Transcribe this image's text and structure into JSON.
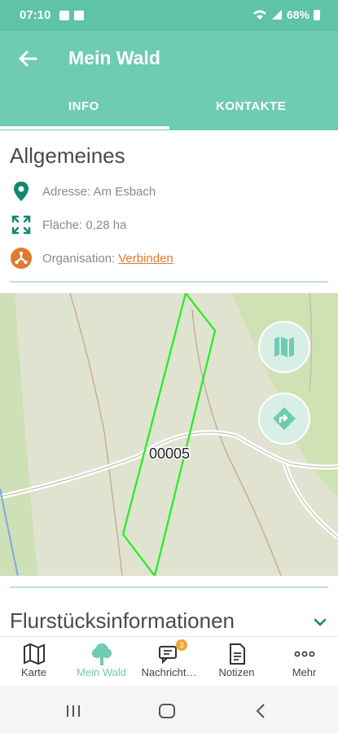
{
  "status": {
    "time": "07:10",
    "battery": "68%"
  },
  "header": {
    "title": "Mein Wald"
  },
  "tabs": [
    {
      "label": "INFO"
    },
    {
      "label": "KONTAKTE"
    }
  ],
  "general": {
    "title": "Allgemeines",
    "address": "Adresse: Am Esbach",
    "area": "Fläche: 0,28 ha",
    "organisation_label": "Organisation:",
    "organisation_link": "Verbinden"
  },
  "map": {
    "parcel_label": "00005"
  },
  "parcel_info": {
    "title": "Flurstücksinformationen"
  },
  "bottom_nav": [
    {
      "label": "Karte",
      "icon": "map-icon"
    },
    {
      "label": "Mein Wald",
      "icon": "tree-icon"
    },
    {
      "label": "Nachricht…",
      "icon": "chat-icon",
      "badge": "3"
    },
    {
      "label": "Notizen",
      "icon": "notes-icon"
    },
    {
      "label": "Mehr",
      "icon": "more-icon"
    }
  ],
  "colors": {
    "primary": "#6fcbb1",
    "status": "#5fc3a8",
    "accent": "#e07a2e",
    "pin": "#0f8a6e",
    "parcel": "#22ee22"
  }
}
